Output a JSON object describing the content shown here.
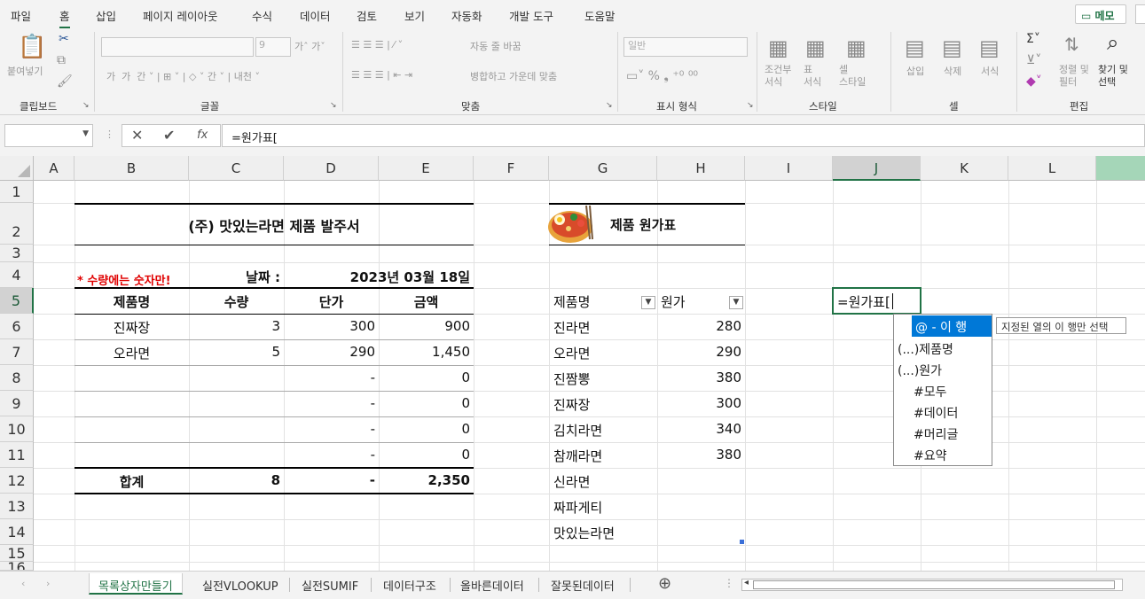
{
  "menu": {
    "items": [
      "파일",
      "홈",
      "삽입",
      "페이지 레이아웃",
      "수식",
      "데이터",
      "검토",
      "보기",
      "자동화",
      "개발 도구",
      "도움말"
    ],
    "memo": "메모"
  },
  "ribbon": {
    "groups": [
      "클립보드",
      "글꼴",
      "맞춤",
      "표시 형식",
      "스타일",
      "셀",
      "편집"
    ],
    "paste": "붙여넣기",
    "font_size": "9",
    "wrap_text": "자동 줄 바꿈",
    "merge": "병합하고 가운데 맞춤",
    "number_format": "일반",
    "cond_format": "조건부\n서식",
    "table_format": "표\n서식",
    "cell_style": "셀\n스타일",
    "insert": "삽입",
    "delete": "삭제",
    "format": "서식",
    "sort_filter": "정렬 및\n필터",
    "find_select": "찾기 및\n선택"
  },
  "formula_bar": {
    "name_box": "",
    "formula": "=원가표["
  },
  "columns": [
    "A",
    "B",
    "C",
    "D",
    "E",
    "F",
    "G",
    "H",
    "I",
    "J",
    "K",
    "L"
  ],
  "rows": [
    "1",
    "2",
    "3",
    "4",
    "5",
    "6",
    "7",
    "8",
    "9",
    "10",
    "11",
    "12",
    "13",
    "14",
    "15",
    "16"
  ],
  "order": {
    "title": "(주) 맛있는라면 제품 발주서",
    "note": "* 수량에는 숫자만!",
    "date_label": "날짜 :",
    "date_value": "2023년 03월 18일",
    "headers": [
      "제품명",
      "수량",
      "단가",
      "금액"
    ],
    "rows": [
      {
        "name": "진짜장",
        "qty": "3",
        "price": "300",
        "amount": "900"
      },
      {
        "name": "오라면",
        "qty": "5",
        "price": "290",
        "amount": "1,450"
      },
      {
        "name": "",
        "qty": "",
        "price": "-",
        "amount": "0"
      },
      {
        "name": "",
        "qty": "",
        "price": "-",
        "amount": "0"
      },
      {
        "name": "",
        "qty": "",
        "price": "-",
        "amount": "0"
      },
      {
        "name": "",
        "qty": "",
        "price": "-",
        "amount": "0"
      }
    ],
    "total": {
      "label": "합계",
      "qty": "8",
      "price": "-",
      "amount": "2,350"
    }
  },
  "cost": {
    "title": "제품 원가표",
    "headers": [
      "제품명",
      "원가"
    ],
    "rows": [
      {
        "name": "진라면",
        "cost": "280"
      },
      {
        "name": "오라면",
        "cost": "290"
      },
      {
        "name": "진짬뽕",
        "cost": "380"
      },
      {
        "name": "진짜장",
        "cost": "300"
      },
      {
        "name": "김치라면",
        "cost": "340"
      },
      {
        "name": "참깨라면",
        "cost": "380"
      },
      {
        "name": "신라면",
        "cost": ""
      },
      {
        "name": "짜파게티",
        "cost": ""
      },
      {
        "name": "맛있는라면",
        "cost": ""
      }
    ]
  },
  "active_cell": {
    "text": "=원가표["
  },
  "autocomplete": {
    "items": [
      "@ - 이 행",
      "(...)제품명",
      "(...)원가",
      "#모두",
      "#데이터",
      "#머리글",
      "#요약"
    ],
    "tooltip": "지정된 열의 이 행만 선택"
  },
  "sheets": [
    "목록상자만들기",
    "실전VLOOKUP",
    "실전SUMIF",
    "데이터구조",
    "올바른데이터",
    "잘못된데이터"
  ]
}
